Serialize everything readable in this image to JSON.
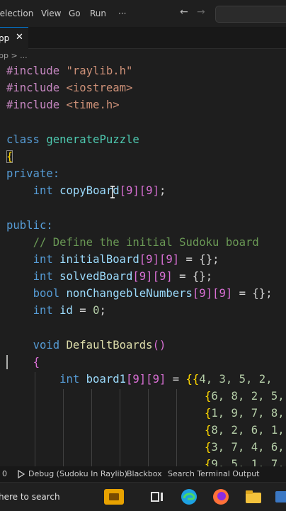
{
  "menubar": {
    "items": [
      "Selection",
      "View",
      "Go",
      "Run"
    ],
    "more_label": "···",
    "back_arrow": "←",
    "forward_arrow": "→"
  },
  "tab": {
    "label": "pp",
    "close": "✕"
  },
  "breadcrumb": {
    "text": "pp > ..."
  },
  "code": {
    "include1": {
      "kw": "#include",
      "arg": "\"raylib.h\""
    },
    "include2": {
      "kw": "#include",
      "arg": "<iostream>"
    },
    "include3": {
      "kw": "#include",
      "arg": "<time.h>"
    },
    "class_line": {
      "kw": "class",
      "name": "generatePuzzle"
    },
    "open_brace": "{",
    "private_label": "private:",
    "copy_board": {
      "type": "int",
      "name": "copyBoard",
      "dims": "[9][9]",
      "end": ";"
    },
    "public_label": "public:",
    "comment": "// Define the initial Sudoku board",
    "initial_board": {
      "type": "int",
      "name": "initialBoard",
      "dims": "[9][9]",
      "rest": " = {};"
    },
    "solved_board": {
      "type": "int",
      "name": "solvedBoard",
      "dims": "[9][9]",
      "rest": " = {};"
    },
    "nonchange": {
      "type": "bool",
      "name": "nonChangebleNumbers",
      "dims": "[9][9]",
      "rest": " = {};"
    },
    "id_line": {
      "type": "int",
      "name": "id",
      "rest": " = ",
      "num": "0",
      "end": ";"
    },
    "func_line": {
      "type": "void",
      "name": "DefaultBoards",
      "parens": "()"
    },
    "func_brace": "{",
    "board1": {
      "type": "int",
      "name": "board1",
      "dims": "[9][9]",
      "eq": " = ",
      "open": "{{",
      "values": "4, 3, 5, 2,"
    },
    "rows": [
      {
        "open": "{",
        "values": "6, 8, 2, 5,"
      },
      {
        "open": "{",
        "values": "1, 9, 7, 8,"
      },
      {
        "open": "{",
        "values": "8, 2, 6, 1,"
      },
      {
        "open": "{",
        "values": "3, 7, 4, 6,"
      },
      {
        "open": "{",
        "values": "9, 5, 1, 7,"
      }
    ]
  },
  "statusbar": {
    "errors": "0",
    "debug": "Debug (Sudoku In Raylib)",
    "blackbox": "Blackbox",
    "search_output": "Search Terminal Output"
  },
  "taskbar": {
    "search_text": "here to search"
  },
  "colors": {
    "keyword": "#569cd6",
    "preproc": "#c586c0",
    "string": "#ce9178",
    "type_name": "#4ec9b0",
    "variable": "#9cdcfe",
    "function": "#dcdcaa",
    "number": "#b5cea8",
    "comment": "#6a9955",
    "bracket_gold": "#ffd700",
    "bracket_pink": "#da70d6"
  }
}
